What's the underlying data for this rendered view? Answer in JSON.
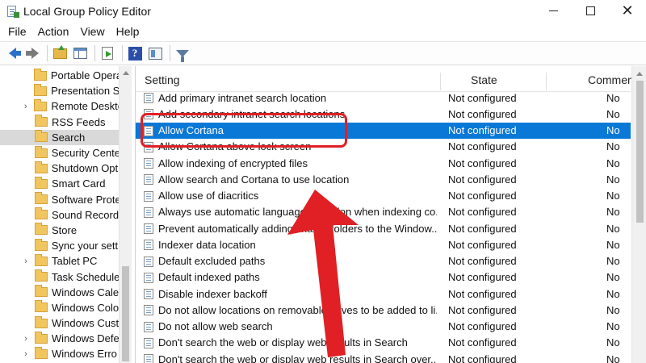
{
  "window": {
    "title": "Local Group Policy Editor",
    "controls": {
      "minimize": "—",
      "maximize": "☐",
      "close": "✕"
    }
  },
  "menu": [
    "File",
    "Action",
    "View",
    "Help"
  ],
  "toolbar": {
    "icons": [
      "back-icon",
      "forward-icon",
      "up-folder-icon",
      "show-hide-tree-icon",
      "export-list-icon",
      "help-icon",
      "properties-icon",
      "filter-icon"
    ],
    "help_glyph": "?"
  },
  "tree": {
    "items": [
      {
        "label": "Portable Operati",
        "expander": ""
      },
      {
        "label": "Presentation Se",
        "expander": ""
      },
      {
        "label": "Remote Deskto",
        "expander": "›"
      },
      {
        "label": "RSS Feeds",
        "expander": ""
      },
      {
        "label": "Search",
        "expander": "",
        "selected": true
      },
      {
        "label": "Security Cente",
        "expander": ""
      },
      {
        "label": "Shutdown Opti",
        "expander": ""
      },
      {
        "label": "Smart Card",
        "expander": ""
      },
      {
        "label": "Software Prote",
        "expander": ""
      },
      {
        "label": "Sound Record",
        "expander": ""
      },
      {
        "label": "Store",
        "expander": ""
      },
      {
        "label": "Sync your setti",
        "expander": ""
      },
      {
        "label": "Tablet PC",
        "expander": "›"
      },
      {
        "label": "Task Schedule",
        "expander": ""
      },
      {
        "label": "Windows Cale",
        "expander": ""
      },
      {
        "label": "Windows Colo",
        "expander": ""
      },
      {
        "label": "Windows Cust",
        "expander": ""
      },
      {
        "label": "Windows Defe",
        "expander": "›"
      },
      {
        "label": "Windows Erro",
        "expander": "›"
      }
    ]
  },
  "list": {
    "columns": {
      "setting": "Setting",
      "state": "State",
      "comment": "Commen"
    },
    "rows": [
      {
        "name": "Add primary intranet search location",
        "state": "Not configured",
        "comment": "No"
      },
      {
        "name": "Add secondary intranet search locations",
        "state": "Not configured",
        "comment": "No"
      },
      {
        "name": "Allow Cortana",
        "state": "Not configured",
        "comment": "No",
        "selected": true
      },
      {
        "name": "Allow Cortana above lock screen",
        "state": "Not configured",
        "comment": "No"
      },
      {
        "name": "Allow indexing of encrypted files",
        "state": "Not configured",
        "comment": "No"
      },
      {
        "name": "Allow search and Cortana to use location",
        "state": "Not configured",
        "comment": "No"
      },
      {
        "name": "Allow use of diacritics",
        "state": "Not configured",
        "comment": "No"
      },
      {
        "name": "Always use automatic language detection when indexing co...",
        "state": "Not configured",
        "comment": "No"
      },
      {
        "name": "Prevent automatically adding shared folders to the Window...",
        "state": "Not configured",
        "comment": "No"
      },
      {
        "name": "Indexer data location",
        "state": "Not configured",
        "comment": "No"
      },
      {
        "name": "Default excluded paths",
        "state": "Not configured",
        "comment": "No"
      },
      {
        "name": "Default indexed paths",
        "state": "Not configured",
        "comment": "No"
      },
      {
        "name": "Disable indexer backoff",
        "state": "Not configured",
        "comment": "No"
      },
      {
        "name": "Do not allow locations on removable drives to be added to li...",
        "state": "Not configured",
        "comment": "No"
      },
      {
        "name": "Do not allow web search",
        "state": "Not configured",
        "comment": "No"
      },
      {
        "name": "Don't search the web or display web results in Search",
        "state": "Not configured",
        "comment": "No"
      },
      {
        "name": "Don't search the web or display web results in Search over...",
        "state": "Not configured",
        "comment": "No"
      }
    ]
  },
  "colors": {
    "selection": "#0a78d7",
    "annotation": "#e02024",
    "tree_selection": "#d9d9d9"
  }
}
